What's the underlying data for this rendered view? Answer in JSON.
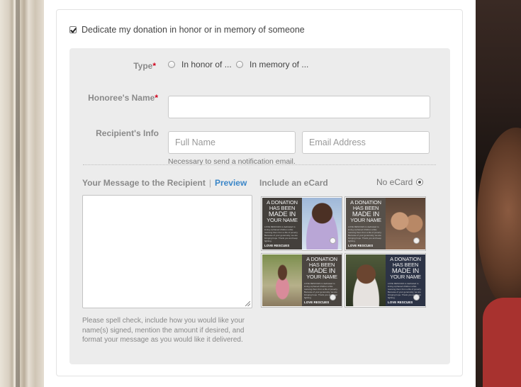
{
  "dedication": {
    "checkbox_label": "Dedicate my donation in honor or in memory of someone",
    "checked": true
  },
  "type": {
    "label": "Type",
    "required_mark": "*",
    "options": [
      "In honor of ...",
      "In memory of ..."
    ]
  },
  "honoree": {
    "label": "Honoree's Name",
    "required_mark": "*",
    "value": ""
  },
  "recipient": {
    "label": "Recipient's Info",
    "full_name_placeholder": "Full Name",
    "email_placeholder": "Email Address",
    "hint": "Necessary to send a notification email."
  },
  "message": {
    "heading": "Your Message to the Recipient",
    "separator": "|",
    "preview_link": "Preview",
    "value": "",
    "hint": "Please spell check, include how you would like your name(s) signed, mention the amount if desired, and format your message as you would like it delivered."
  },
  "ecard": {
    "heading": "Include an eCard",
    "no_ecard_label": "No eCard",
    "no_ecard_selected": true,
    "cards": [
      {
        "headline_top": "A DONATION",
        "headline_mid": "HAS BEEN",
        "headline_main": "MADE IN",
        "headline_bottom": "YOUR NAME",
        "brand": "LOVE RESCUES"
      },
      {
        "headline_top": "A DONATION",
        "headline_mid": "HAS BEEN",
        "headline_main": "MADE IN",
        "headline_bottom": "YOUR NAME",
        "brand": "LOVE RESCUES"
      },
      {
        "headline_top": "A DONATION",
        "headline_mid": "HAS BEEN",
        "headline_main": "MADE IN",
        "headline_bottom": "YOUR NAME",
        "brand": "LOVE RESCUES"
      },
      {
        "headline_top": "A DONATION",
        "headline_mid": "HAS BEEN",
        "headline_main": "MADE IN",
        "headline_bottom": "YOUR NAME",
        "brand": "LOVE RESCUES"
      }
    ],
    "card_body_text": "LOVE RESCUES is dedicated to loving orphaned children while rescuing them from a life of poverty. Because of your generosity, we are bringing hope. Thank you and keep fighting."
  },
  "colors": {
    "required": "#d0021b",
    "link": "#3a86c8",
    "inner_panel": "#ececec"
  }
}
